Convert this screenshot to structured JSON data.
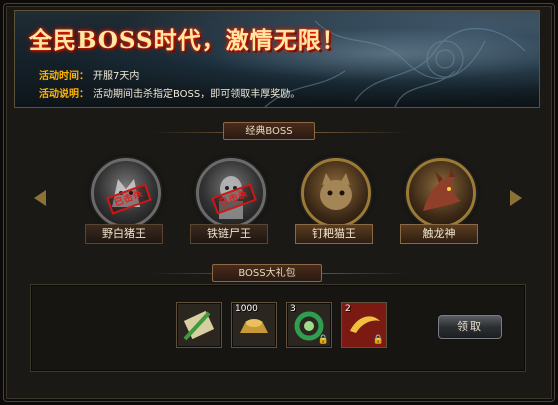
{
  "banner": {
    "title": "全民BOSS时代，激情无限！",
    "time_label": "活动时间：",
    "time_value": "开服7天内",
    "desc_label": "活动说明：",
    "desc_value": "活动期间击杀指定BOSS，即可领取丰厚奖励。"
  },
  "boss_section": {
    "tab_label": "经典BOSS",
    "bosses": [
      {
        "name": "野白猪王",
        "stamp": "已击杀",
        "defeated": true
      },
      {
        "name": "铁链尸王",
        "stamp": "已击杀",
        "defeated": true
      },
      {
        "name": "钉耙猫王",
        "defeated": false
      },
      {
        "name": "触龙神",
        "defeated": false
      }
    ]
  },
  "gift_section": {
    "tab_label": "BOSS大礼包",
    "items": [
      {
        "icon": "sword-scroll-icon",
        "count": ""
      },
      {
        "icon": "gold-ingot-icon",
        "count": "1000"
      },
      {
        "icon": "jade-ring-icon",
        "count": "3"
      },
      {
        "icon": "crescent-blade-icon",
        "count": "2"
      }
    ],
    "claim_label": "领取",
    "colors": {
      "accent": "#ffb400",
      "stamp_red": "#d01717"
    }
  }
}
